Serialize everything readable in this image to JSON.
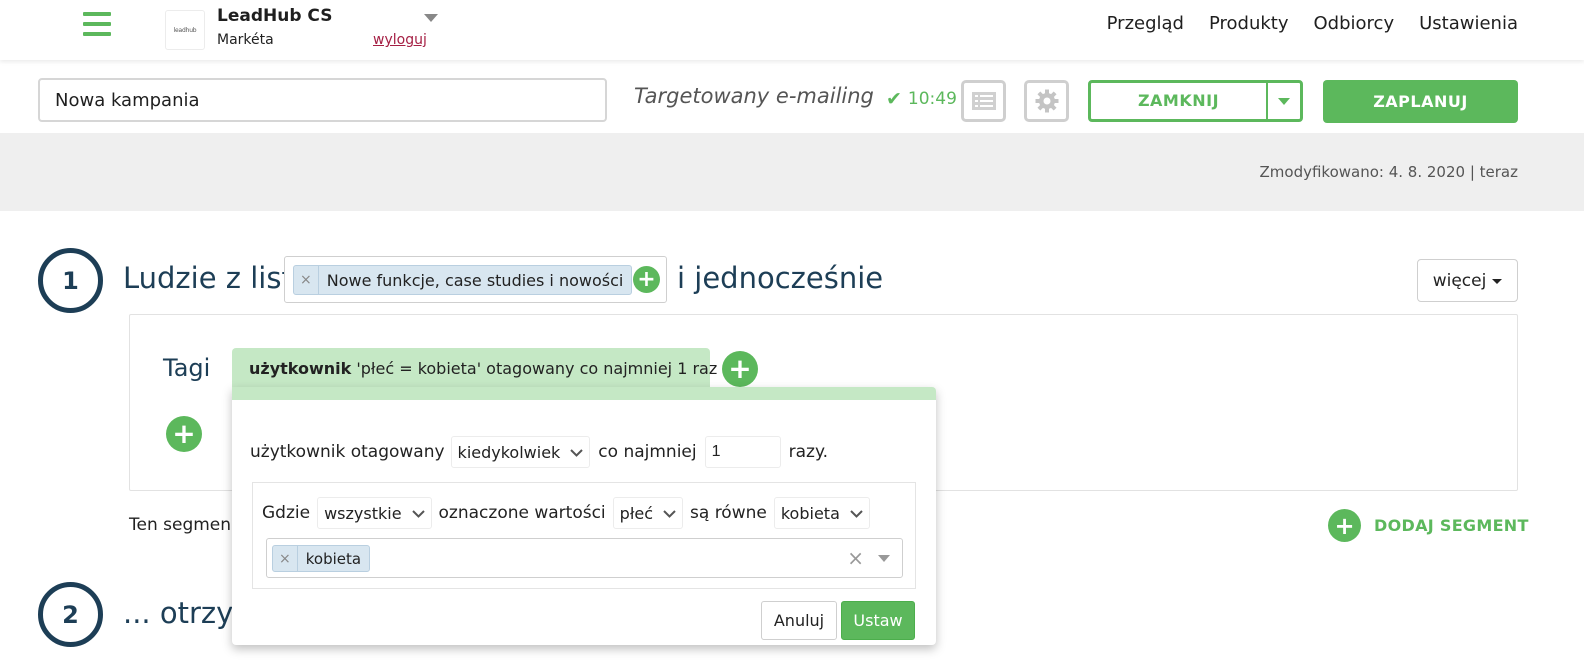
{
  "header": {
    "logo_text": "leadhub",
    "account_name": "LeadHub CS",
    "user_name": "Markéta",
    "logout_label": "wyloguj",
    "nav": [
      "Przegląd",
      "Produkty",
      "Odbiorcy",
      "Ustawienia"
    ]
  },
  "toolbar": {
    "campaign_name": "Nowa kampania",
    "campaign_type": "Targetowany e-mailing",
    "saved_time": "10:49",
    "close_label": "ZAMKNIJ",
    "schedule_label": "ZAPLANUJ"
  },
  "modified": "Zmodyfikowano: 4. 8. 2020 | teraz",
  "step1": {
    "number": "1",
    "title": "Ludzie z list",
    "list_chip": "Nowe funkcje, case studies i nowości",
    "conjunction": "i jednocześnie",
    "more_label": "więcej"
  },
  "segment": {
    "tags_label": "Tagi",
    "tag_summary_bold": "użytkownik",
    "tag_summary_rest": " 'płeć = kobieta' otagowany co najmniej 1 raz",
    "note": "Ten segmen",
    "add_segment_label": "DODAJ SEGMENT"
  },
  "popup": {
    "row1_label": "użytkownik otagowany",
    "when_value": "kiedykolwiek",
    "at_least_label": "co najmniej",
    "count_value": "1",
    "times_label": "razy.",
    "where_label": "Gdzie",
    "quantifier_value": "wszystkie",
    "marked_label": "oznaczone wartości",
    "field_value": "płeć",
    "equal_label": "są równe",
    "operator_value": "kobieta",
    "value_chip": "kobieta",
    "cancel_label": "Anuluj",
    "set_label": "Ustaw"
  },
  "step2": {
    "number": "2",
    "title": "... otrzym"
  },
  "colors": {
    "green": "#5cb85c",
    "navy": "#1d3e56",
    "tag_green": "#c5e8c5",
    "chip_blue": "#d8e6f0",
    "logout_red": "#a51f44"
  }
}
